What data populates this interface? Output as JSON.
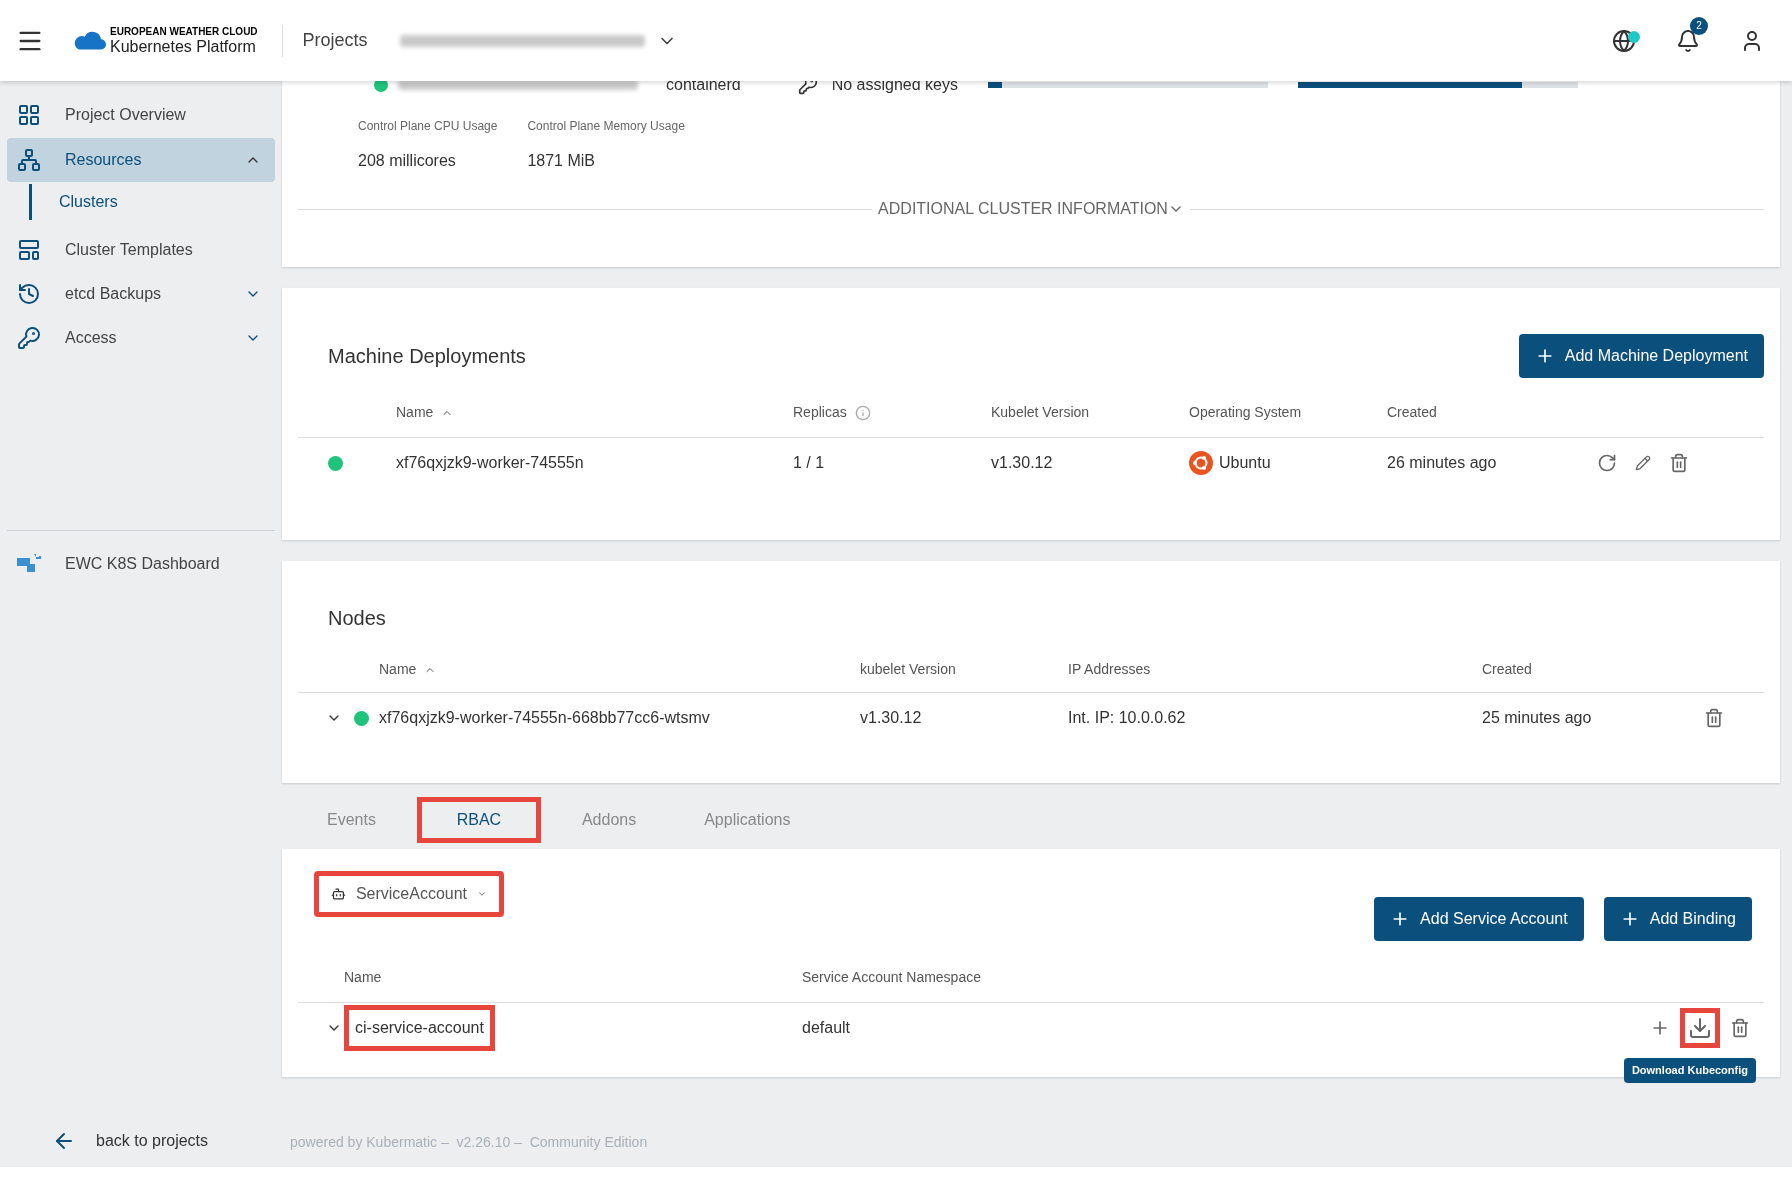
{
  "header": {
    "brand_line1": "EUROPEAN WEATHER CLOUD",
    "brand_line2": "Kubernetes Platform",
    "projects_label": "Projects",
    "notification_count": "2"
  },
  "sidebar": {
    "items": [
      {
        "label": "Project Overview",
        "kind": "grid",
        "selected": false
      },
      {
        "label": "Resources",
        "kind": "tree",
        "selected": true,
        "expanded": true,
        "children": [
          {
            "label": "Clusters",
            "selected": true
          }
        ]
      },
      {
        "label": "Cluster Templates",
        "kind": "template",
        "selected": false
      },
      {
        "label": "etcd Backups",
        "kind": "history",
        "selected": false,
        "expanded": false
      },
      {
        "label": "Access",
        "kind": "key",
        "selected": false,
        "expanded": false
      }
    ],
    "dashboard_link": "EWC K8S Dashboard",
    "back_link": "back to projects"
  },
  "cluster_card": {
    "runtime": "containerd",
    "keys": "No assigned keys",
    "bars": [
      {
        "level": 0.05
      },
      {
        "level": 0.8
      }
    ],
    "stats": [
      {
        "label": "Control Plane CPU Usage",
        "value": "208 millicores"
      },
      {
        "label": "Control Plane Memory Usage",
        "value": "1871 MiB"
      }
    ],
    "additional_info": "ADDITIONAL CLUSTER INFORMATION"
  },
  "machine_deployments": {
    "title": "Machine Deployments",
    "add_button": "Add Machine Deployment",
    "columns": [
      "Name",
      "Replicas",
      "Kubelet Version",
      "Operating System",
      "Created"
    ],
    "rows": [
      {
        "color": "#1fc47a",
        "name": "xf76qxjzk9-worker-74555n",
        "replicas": "1 / 1",
        "kubelet": "v1.30.12",
        "os": "Ubuntu",
        "created": "26 minutes ago"
      }
    ]
  },
  "nodes": {
    "title": "Nodes",
    "columns": [
      "Name",
      "kubelet Version",
      "IP Addresses",
      "Created"
    ],
    "rows": [
      {
        "expanded": false,
        "color": "#1fc47a",
        "name": "xf76qxjzk9-worker-74555n-668bb77cc6-wtsmv",
        "kubelet": "v1.30.12",
        "ip": "Int. IP: 10.0.0.62",
        "created": "25 minutes ago"
      }
    ]
  },
  "tabs": [
    {
      "label": "Events",
      "selected": false,
      "highlighted": false
    },
    {
      "label": "RBAC",
      "selected": true,
      "highlighted": true
    },
    {
      "label": "Addons",
      "selected": false,
      "highlighted": false
    },
    {
      "label": "Applications",
      "selected": false,
      "highlighted": false
    }
  ],
  "rbac": {
    "type_select": {
      "value": "ServiceAccount",
      "highlighted": true
    },
    "buttons": [
      "Add Service Account",
      "Add Binding"
    ],
    "columns": [
      "Name",
      "Service Account Namespace"
    ],
    "rows": [
      {
        "expanded": false,
        "name": "ci-service-account",
        "name_highlighted": true,
        "namespace": "default",
        "download_highlighted": true,
        "tooltip": "Download Kubeconfig"
      }
    ]
  },
  "footer": {
    "text": "powered by Kubermatic –  v2.26.10 –  Community Edition"
  }
}
